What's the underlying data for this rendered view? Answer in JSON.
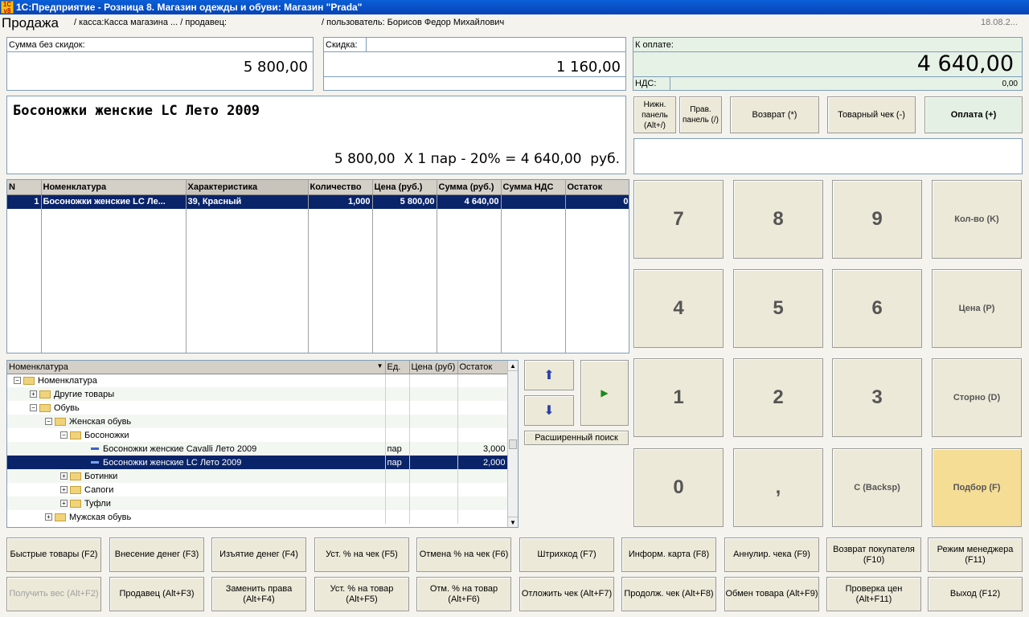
{
  "window": {
    "title": "1С:Предприятие - Розница 8. Магазин одежды и обуви: Магазин \"Prada\"",
    "icon": "1c-app-icon"
  },
  "header": {
    "mode": "Продажа",
    "kassa": "/ касса:Касса магазина ... / продавец:",
    "user": "/ пользователь: Борисов Федор Михайлович",
    "date": "18.08.2..."
  },
  "totals": {
    "sum_label": "Сумма без скидок:",
    "sum_value": "5 800,00",
    "discount_label": "Скидка:",
    "discount_value": "1 160,00",
    "pay_label": "К оплате:",
    "pay_value": "4 640,00",
    "vat_label": "НДС:",
    "vat_value": "0,00"
  },
  "item_display": {
    "name": "Босоножки женские LC Лето 2009",
    "calc": "5 800,00  Х 1 пар - 20% = 4 640,00  руб."
  },
  "top_buttons": {
    "lower_panel": "Нижн. панель (Alt+/)",
    "right_panel": "Прав. панель (/)",
    "return": "Возврат (*)",
    "receipt": "Товарный чек (-)",
    "pay": "Оплата (+)"
  },
  "cart": {
    "columns": [
      "N",
      "Номенклатура",
      "Характеристика",
      "Количество",
      "Цена (руб.)",
      "Сумма (руб.)",
      "Сумма НДС",
      "Остаток"
    ],
    "rows": [
      {
        "n": "1",
        "name": "Босоножки женские LC Ле...",
        "char": "39, Красный",
        "qty": "1,000",
        "price": "5 800,00",
        "sum": "4 640,00",
        "vat": "",
        "rest": "0"
      }
    ]
  },
  "catalog": {
    "columns": [
      "Номенклатура",
      "Ед.",
      "Цена (руб)",
      "Остаток"
    ],
    "rows": [
      {
        "label": "Номенклатура",
        "unit": "",
        "rest": ""
      },
      {
        "label": "Другие товары",
        "unit": "",
        "rest": ""
      },
      {
        "label": "Обувь",
        "unit": "",
        "rest": ""
      },
      {
        "label": "Женская обувь",
        "unit": "",
        "rest": ""
      },
      {
        "label": "Босоножки",
        "unit": "",
        "rest": ""
      },
      {
        "label": "Босоножки женские Cavalli Лето 2009",
        "unit": "пар",
        "rest": "3,000"
      },
      {
        "label": "Босоножки женские LC Лето 2009",
        "unit": "пар",
        "rest": "2,000"
      },
      {
        "label": "Ботинки",
        "unit": "",
        "rest": ""
      },
      {
        "label": "Сапоги",
        "unit": "",
        "rest": ""
      },
      {
        "label": "Туфли",
        "unit": "",
        "rest": ""
      },
      {
        "label": "Мужская обувь",
        "unit": "",
        "rest": ""
      }
    ]
  },
  "search": {
    "extended_label": "Расширенный поиск"
  },
  "keypad": {
    "k7": "7",
    "k8": "8",
    "k9": "9",
    "qty": "Кол-во (K)",
    "k4": "4",
    "k5": "5",
    "k6": "6",
    "price": "Цена (P)",
    "k1": "1",
    "k2": "2",
    "k3": "3",
    "storno": "Сторно (D)",
    "k0": "0",
    "comma": ",",
    "backspace": "С (Backsp)",
    "pick": "Подбор (F)"
  },
  "fkeys_row1": [
    "Быстрые товары (F2)",
    "Внесение денег (F3)",
    "Изъятие денег (F4)",
    "Уст. % на чек (F5)",
    "Отмена % на чек (F6)",
    "Штрихкод (F7)",
    "Информ. карта (F8)",
    "Аннулир. чека (F9)",
    "Возврат покупателя (F10)",
    "Режим менеджера (F11)"
  ],
  "fkeys_row2": [
    "Получить вес (Alt+F2)",
    "Продавец (Alt+F3)",
    "Заменить права (Alt+F4)",
    "Уст. % на товар (Alt+F5)",
    "Отм. % на товар (Alt+F6)",
    "Отложить чек (Alt+F7)",
    "Продолж. чек (Alt+F8)",
    "Обмен товара (Alt+F9)",
    "Проверка цен (Alt+F11)",
    "Выход (F12)"
  ]
}
